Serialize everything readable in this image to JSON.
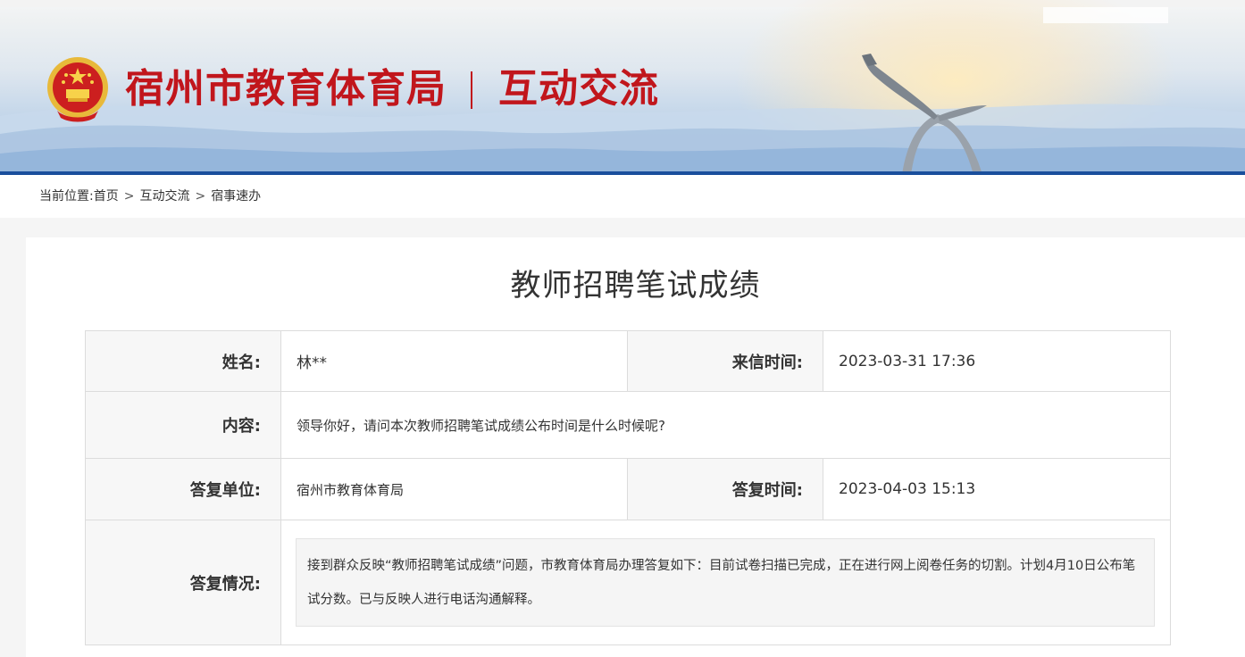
{
  "header": {
    "site_name": "宿州市教育体育局",
    "section_name": "互动交流"
  },
  "breadcrumb": {
    "label": "当前位置:",
    "items": [
      "首页",
      "互动交流",
      "宿事速办"
    ],
    "separator": ">"
  },
  "letter": {
    "title": "教师招聘笔试成绩",
    "name_label": "姓名:",
    "name_value": "林**",
    "sent_time_label": "来信时间:",
    "sent_time_value": "2023-03-31 17:36",
    "content_label": "内容:",
    "content_value": "领导你好，请问本次教师招聘笔试成绩公布时间是什么时候呢?",
    "reply_unit_label": "答复单位:",
    "reply_unit_value": "宿州市教育体育局",
    "reply_time_label": "答复时间:",
    "reply_time_value": "2023-04-03 15:13",
    "reply_status_label": "答复情况:",
    "reply_status_value": "接到群众反映“教师招聘笔试成绩”问题，市教育体育局办理答复如下：目前试卷扫描已完成，正在进行网上阅卷任务的切割。计划4月10日公布笔试分数。已与反映人进行电话沟通解释。"
  },
  "colors": {
    "brand_red": "#c1161c",
    "banner_line": "#1a4f9c",
    "label_bg": "#f7f7f7",
    "border": "#dcdcdc"
  },
  "icons": {
    "emblem": "national-emblem-icon",
    "sculpture": "bird-sculpture-graphic"
  }
}
